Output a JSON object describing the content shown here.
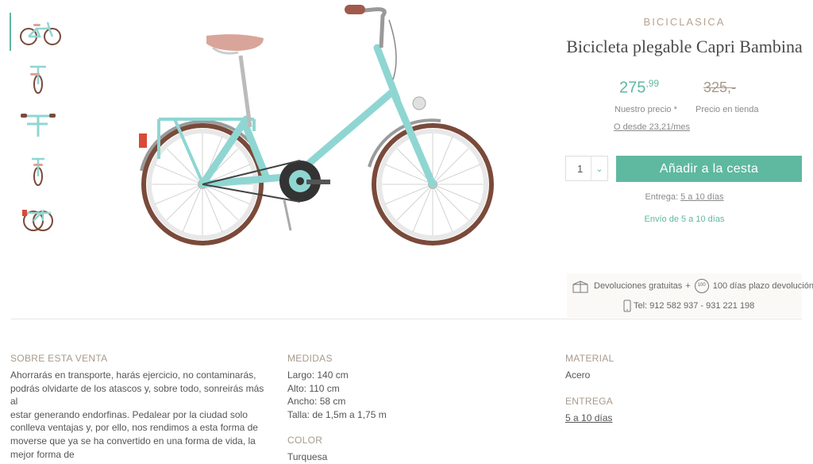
{
  "thumbnails": [
    {
      "name": "bike-side-view"
    },
    {
      "name": "bike-front-view"
    },
    {
      "name": "bike-handlebar-detail"
    },
    {
      "name": "bike-rear-view"
    },
    {
      "name": "bike-folded-view"
    }
  ],
  "product": {
    "brand": "BICICLASICA",
    "title": "Bicicleta plegable Capri Bambina",
    "price": {
      "our_price_int": "275",
      "our_price_dec": ",99",
      "our_price_label": "Nuestro precio *",
      "store_price": "325,-",
      "store_price_label": "Precio en tienda"
    },
    "financing": "O desde 23,21/mes",
    "quantity": "1",
    "add_to_cart": "Añadir a la cesta",
    "delivery_label": "Entrega:",
    "delivery_value": "5 a 10 días",
    "shipping": "Envío de 5 a 10 días"
  },
  "guarantee": {
    "returns": "Devoluciones gratuitas",
    "plus": "+",
    "return_days_badge": "100",
    "return_period": "100 días plazo devolución",
    "phone": "Tel: 912 582 937 - 931 221 198"
  },
  "about": {
    "heading": "SOBRE ESTA VENTA",
    "lines": [
      "Ahorrarás en transporte, harás ejercicio, no contaminarás,",
      "podrás olvidarte de los atascos y, sobre todo, sonreirás más al",
      "estar generando endorfinas. Pedalear por la ciudad solo",
      "conlleva ventajas y, por ello, nos rendimos a esta forma de",
      "moverse que ya se ha convertido en una forma de vida, la",
      "mejor forma de"
    ]
  },
  "measures": {
    "heading": "MEDIDAS",
    "items": [
      "Largo: 140 cm",
      "Alto: 110 cm",
      "Ancho: 58 cm",
      "Talla: de 1,5m a 1,75 m"
    ]
  },
  "color": {
    "heading": "COLOR",
    "value": "Turquesa"
  },
  "material": {
    "heading": "MATERIAL",
    "value": "Acero"
  },
  "delivery_section": {
    "heading": "ENTREGA",
    "value": "5 a 10 días"
  },
  "colors": {
    "accent": "#5fb8a0",
    "bike_turquoise": "#8fd6d2",
    "tire_brown": "#7a4a3a",
    "saddle_pink": "#d9a59a",
    "muted_text": "#a89a8c"
  }
}
